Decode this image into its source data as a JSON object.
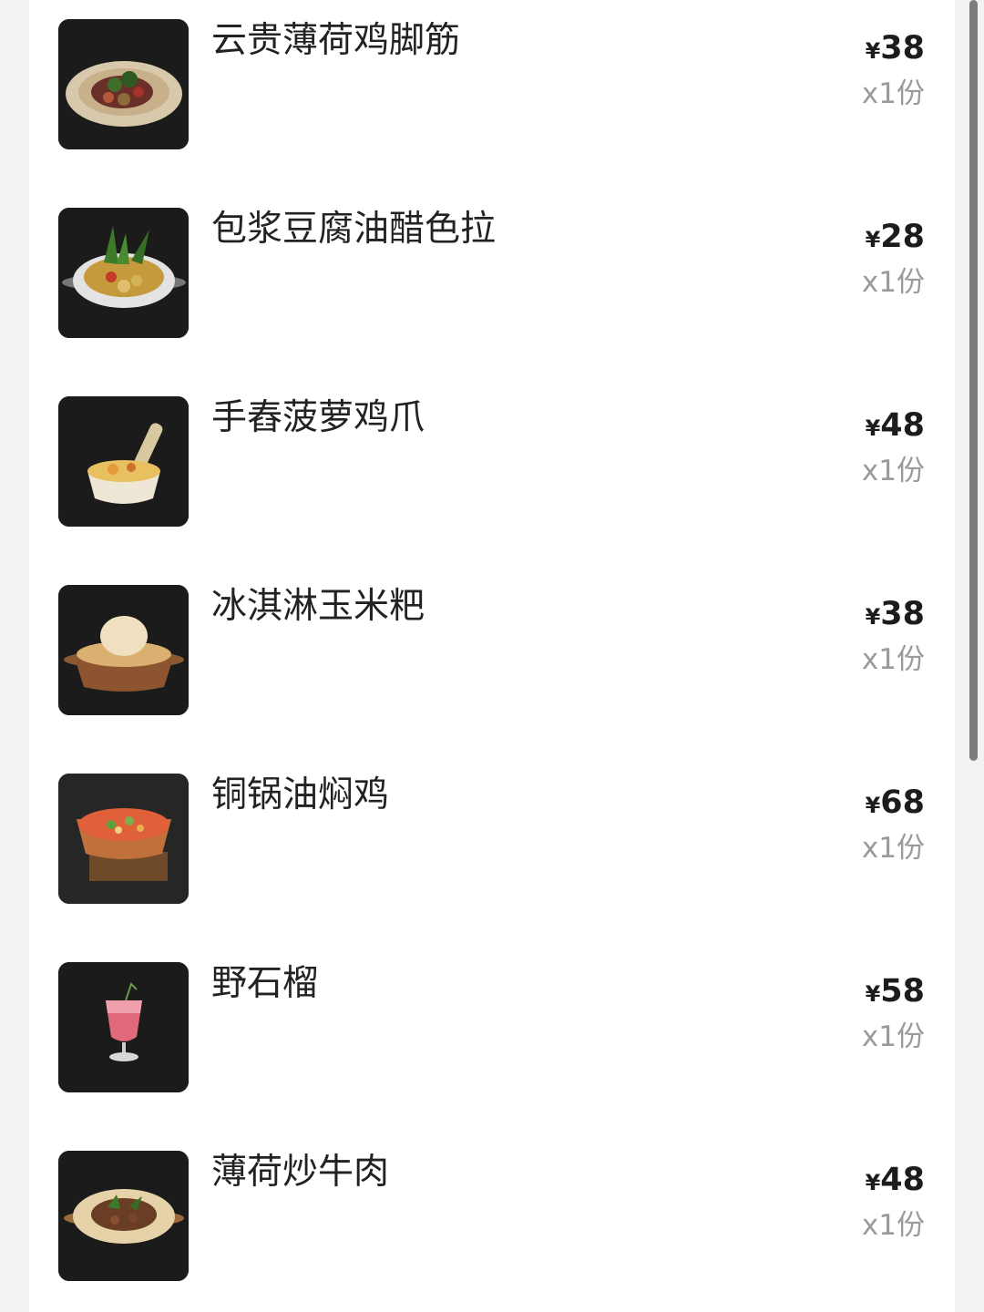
{
  "order_items": [
    {
      "name": "云贵薄荷鸡脚筋",
      "currency": "¥",
      "price": "38",
      "quantity": "x1份",
      "image": "mint-chicken-tendon-plate"
    },
    {
      "name": "包浆豆腐油醋色拉",
      "currency": "¥",
      "price": "28",
      "quantity": "x1份",
      "image": "tofu-salad-bowl"
    },
    {
      "name": "手舂菠萝鸡爪",
      "currency": "¥",
      "price": "48",
      "quantity": "x1份",
      "image": "mortar-pineapple-chicken-feet"
    },
    {
      "name": "冰淇淋玉米粑",
      "currency": "¥",
      "price": "38",
      "quantity": "x1份",
      "image": "corn-cake-copper-pan"
    },
    {
      "name": "铜锅油焖鸡",
      "currency": "¥",
      "price": "68",
      "quantity": "x1份",
      "image": "copper-pot-braised-chicken"
    },
    {
      "name": "野石榴",
      "currency": "¥",
      "price": "58",
      "quantity": "x1份",
      "image": "pomegranate-drink-glass"
    },
    {
      "name": "薄荷炒牛肉",
      "currency": "¥",
      "price": "48",
      "quantity": "x1份",
      "image": "mint-stir-fried-beef-plate"
    }
  ]
}
